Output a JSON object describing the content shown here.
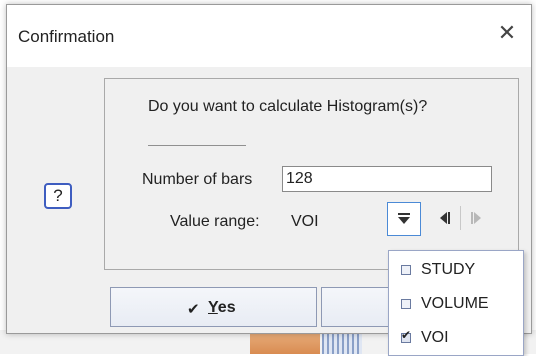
{
  "window": {
    "title": "Confirmation",
    "close_glyph": "✕"
  },
  "dialog": {
    "question": "Do you want to calculate Histogram(s)?",
    "number_of_bars": {
      "label": "Number of bars",
      "value": "128"
    },
    "value_range": {
      "label": "Value range:",
      "value": "VOI"
    }
  },
  "icons": {
    "question": "?",
    "check": "✔"
  },
  "buttons": {
    "yes": {
      "mnemonic": "Y",
      "rest": "es"
    }
  },
  "dropdown": {
    "options": [
      {
        "label": "STUDY",
        "checked": false
      },
      {
        "label": "VOLUME",
        "checked": false
      },
      {
        "label": "VOI",
        "checked": true
      }
    ]
  },
  "colors": {
    "accent": "#3e5dc0",
    "focus_border": "#4b8ad6",
    "dialog_bg": "#f0f0f0"
  }
}
